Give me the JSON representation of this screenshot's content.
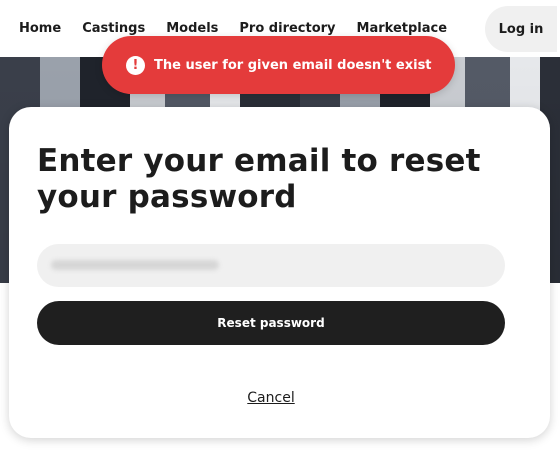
{
  "nav": {
    "items": [
      "Home",
      "Castings",
      "Models",
      "Pro directory",
      "Marketplace"
    ],
    "login_label": "Log in"
  },
  "toast": {
    "icon": "exclamation-icon",
    "message": "The user for given email doesn't exist",
    "color": "#e43b3b"
  },
  "modal": {
    "title": "Enter your email to reset your password",
    "email_value": "",
    "reset_label": "Reset password",
    "cancel_label": "Cancel"
  }
}
